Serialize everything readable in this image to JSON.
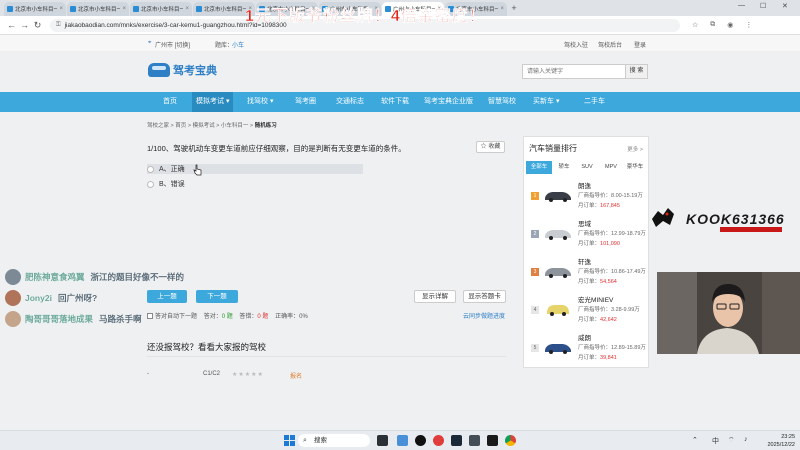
{
  "browser": {
    "tabs": [
      {
        "title": "北京市小车科目一考",
        "active": false
      },
      {
        "title": "北京市小车科目一考",
        "active": false
      },
      {
        "title": "北京市小车科目一考",
        "active": false
      },
      {
        "title": "北京市小车科目一考",
        "active": false
      },
      {
        "title": "北京市小车科目一考",
        "active": false
      },
      {
        "title": "广州市小车科目一考",
        "active": false
      },
      {
        "title": "广州市小车科目一模",
        "active": true
      },
      {
        "title": "北京市小车科目一考",
        "active": false
      }
    ],
    "url": "jiakaobaodian.com/mnks/exercise/3-car-kemu1-guangzhou.html?id=1098300"
  },
  "topbar": {
    "location": "广州市 [切换]",
    "license_label": "题库：",
    "license_value": "小车",
    "login": "驾校入驻",
    "backend": "驾校后台",
    "signin": "登录"
  },
  "site": {
    "logo_text": "驾考宝典",
    "search_placeholder": "请输入关键字",
    "search_button": "搜 索"
  },
  "nav": {
    "items": [
      {
        "label": "首页"
      },
      {
        "label": "模拟考试 ▾"
      },
      {
        "label": "找驾校 ▾"
      },
      {
        "label": "驾考圈"
      },
      {
        "label": "交通标志"
      },
      {
        "label": "软件下载"
      },
      {
        "label": "驾考宝典企业版"
      },
      {
        "label": "智慧驾校"
      },
      {
        "label": "买新车 ▾"
      },
      {
        "label": "二手车"
      }
    ]
  },
  "breadcrumb": {
    "parts": [
      "驾校之家",
      "首页",
      "模拟考试",
      "小车科目一"
    ],
    "current": "随机练习"
  },
  "question": {
    "text": "1/100、驾驶机动车变更车道前应仔细观察，目的是判断有无变更车道的条件。",
    "collect": "☆ 收藏",
    "options": [
      "A、正确",
      "B、错误"
    ],
    "prev": "上一题",
    "next": "下一题",
    "show_detail": "显示详解",
    "answer_sheet": "显示答题卡",
    "auto_next": "答对自动下一题",
    "correct_label": "答对：",
    "correct_value": "0 题",
    "wrong_label": "答错：",
    "wrong_value": "0 题",
    "rate_label": "正确率：",
    "rate_value": "0%",
    "sync": "云同步做题进度"
  },
  "schools": {
    "heading": "还没报驾校？看看大家报的驾校",
    "row": {
      "name": "-",
      "type": "C1/C2",
      "stars": "★★★★★",
      "link": "报名"
    }
  },
  "ranking": {
    "title": "汽车销量排行",
    "more": "更多 >",
    "tabs": [
      "全部车",
      "轿车",
      "SUV",
      "MPV",
      "豪华车"
    ],
    "price_label": "厂商指导价：",
    "sales_label": "月订单：",
    "items": [
      {
        "rank": "1",
        "name": "朗逸",
        "price": "8.00-15.19万",
        "sales": "167,845"
      },
      {
        "rank": "2",
        "name": "思域",
        "price": "12.99-18.79万",
        "sales": "101,090"
      },
      {
        "rank": "3",
        "name": "轩逸",
        "price": "10.86-17.49万",
        "sales": "54,564"
      },
      {
        "rank": "4",
        "name": "宏光MINIEV",
        "price": "3.28-9.99万",
        "sales": "42,642"
      },
      {
        "rank": "5",
        "name": "威朗",
        "price": "12.89-15.89万",
        "sales": "39,841"
      }
    ]
  },
  "overlay": {
    "promo": "1元下版爷粉丝牌！4倍亲密度！",
    "kook": "KOOK631366",
    "chat": [
      {
        "name": "肥陈神意食鸡翼",
        "msg": "浙江的题目好像不一样的"
      },
      {
        "name": "Jony2i",
        "msg": "回广州呀?"
      },
      {
        "name": "陶哥哥哥落地成果",
        "msg": "马路杀手啊"
      }
    ]
  },
  "taskbar": {
    "search": "搜索",
    "lang": "中",
    "time": "23:25",
    "date": "2025/12/22"
  }
}
